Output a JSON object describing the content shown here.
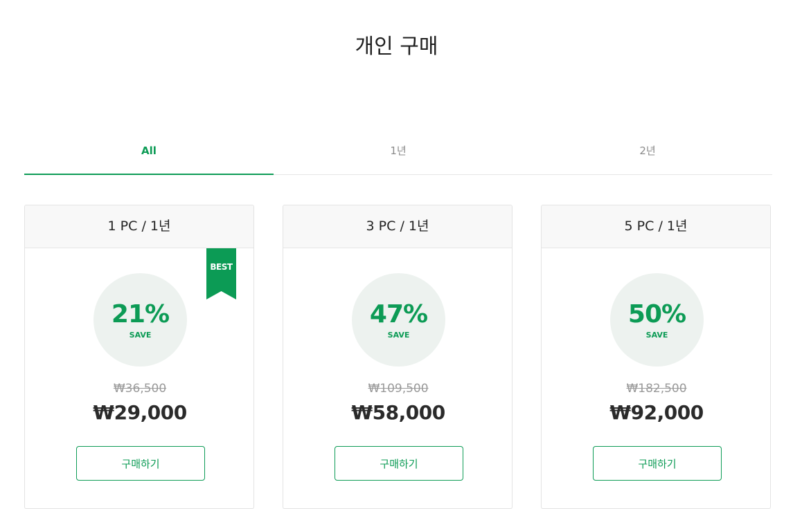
{
  "page": {
    "title": "개인 구매"
  },
  "tabs": [
    {
      "label": "All",
      "active": true
    },
    {
      "label": "1년",
      "active": false
    },
    {
      "label": "2년",
      "active": false
    }
  ],
  "colors": {
    "accent": "#0c9b55",
    "circle_bg": "#edf2ef",
    "header_bg": "#f8f8f8"
  },
  "cards": [
    {
      "title": "1 PC / 1년",
      "badge": "BEST",
      "save_percent": "21%",
      "save_label": "SAVE",
      "original_price": "₩36,500",
      "sale_price": "₩29,000",
      "button_label": "구매하기"
    },
    {
      "title": "3 PC / 1년",
      "save_percent": "47%",
      "save_label": "SAVE",
      "original_price": "₩109,500",
      "sale_price": "₩58,000",
      "button_label": "구매하기"
    },
    {
      "title": "5 PC / 1년",
      "save_percent": "50%",
      "save_label": "SAVE",
      "original_price": "₩182,500",
      "sale_price": "₩92,000",
      "button_label": "구매하기"
    }
  ]
}
